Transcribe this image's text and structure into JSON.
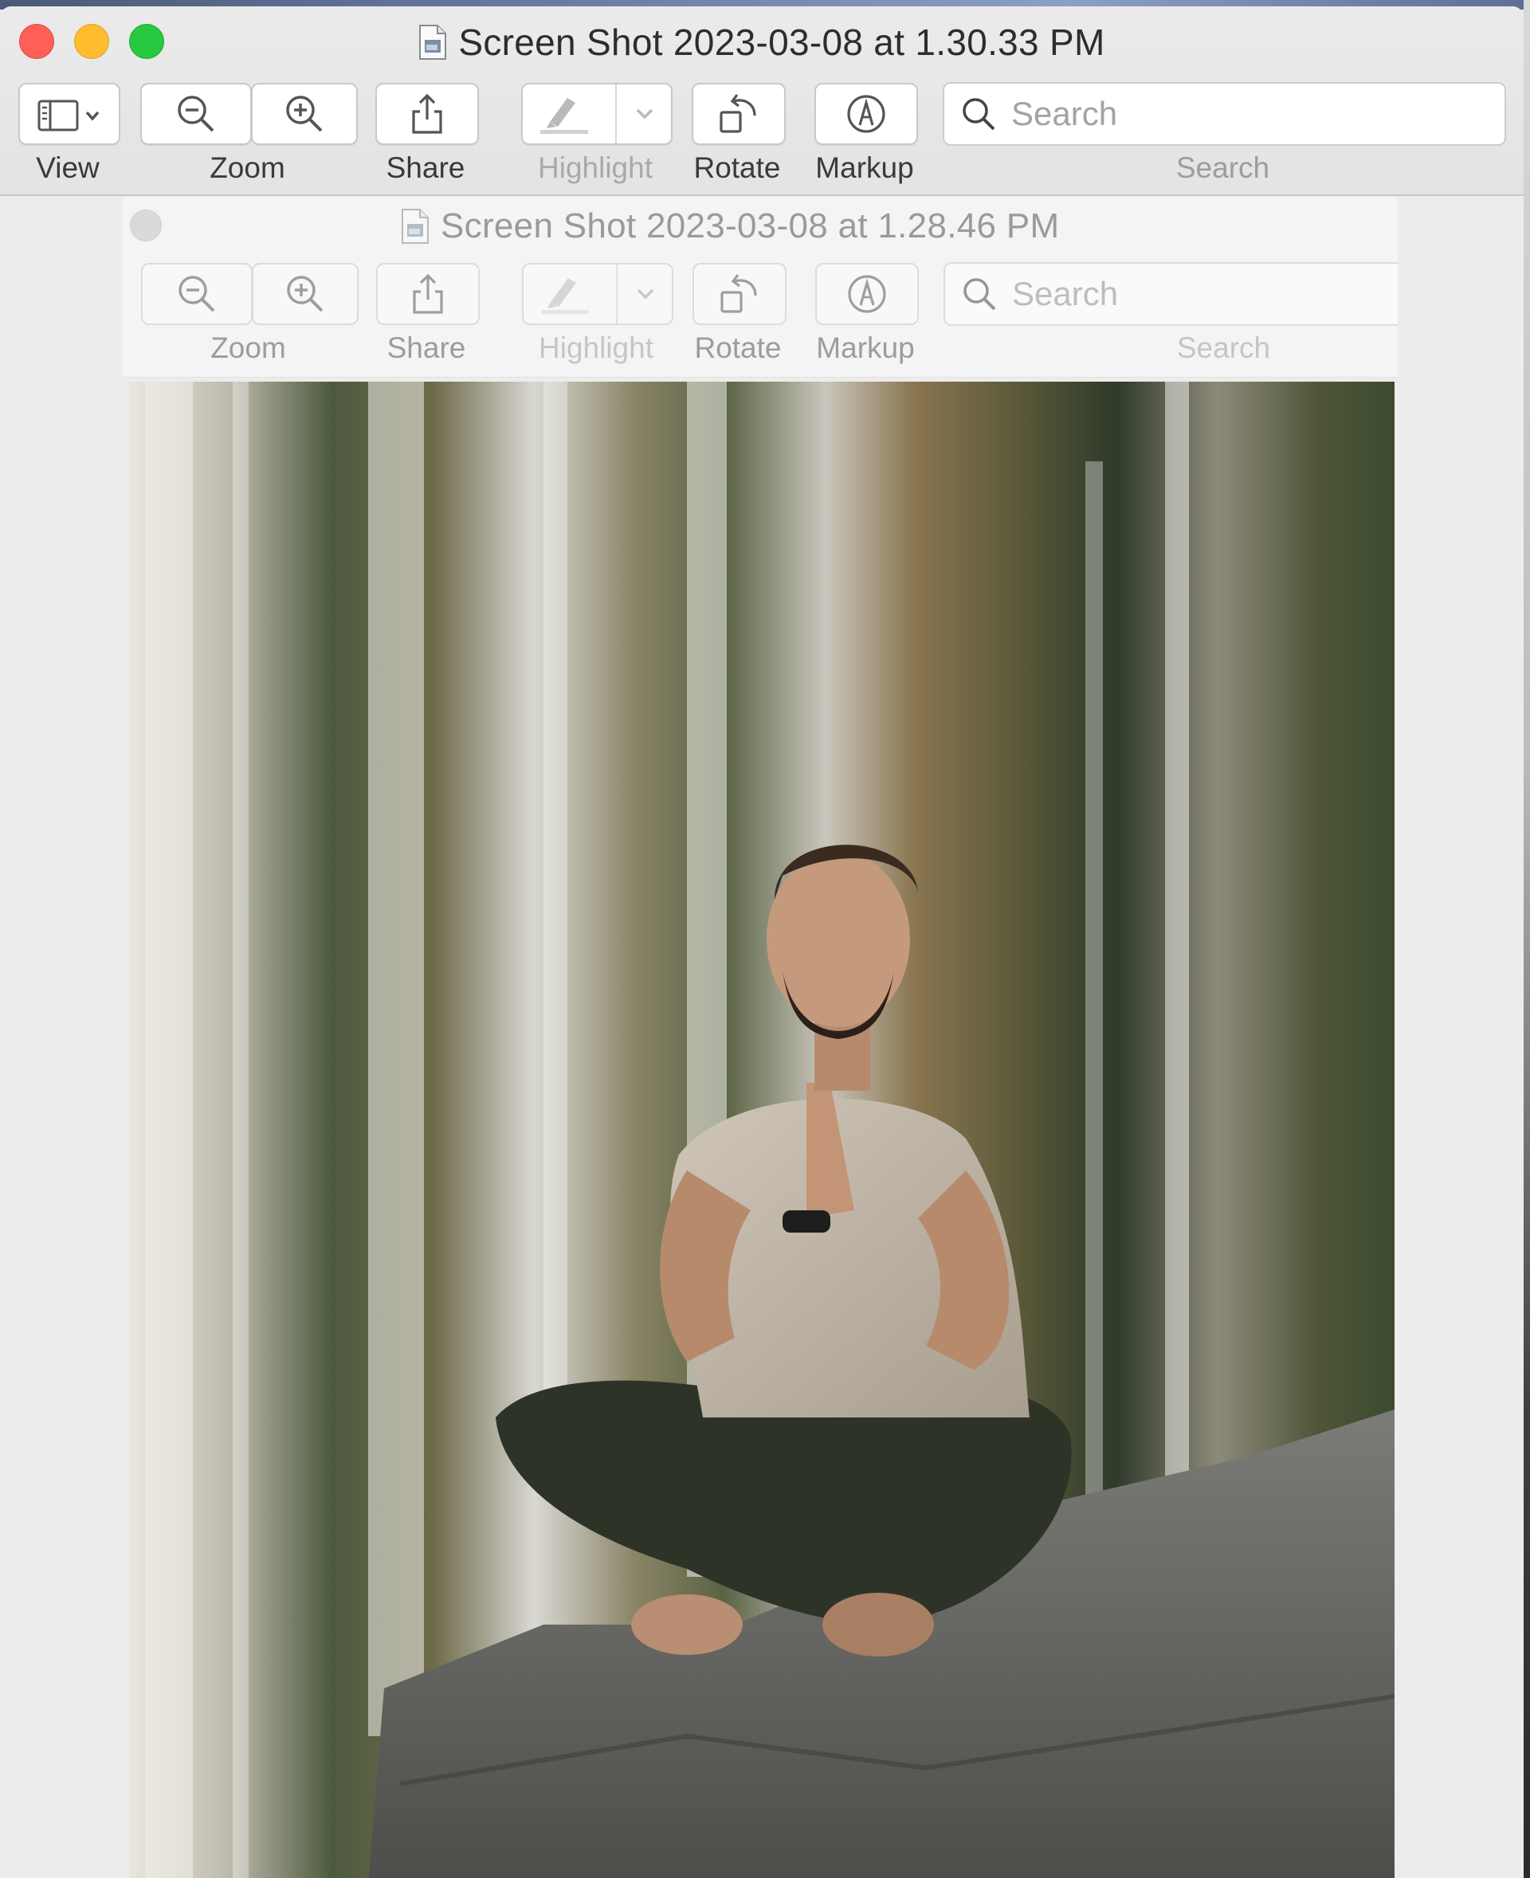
{
  "front_window": {
    "title": "Screen Shot 2023-03-08 at 1.30.33 PM",
    "toolbar": {
      "view_label": "View",
      "zoom_label": "Zoom",
      "share_label": "Share",
      "highlight_label": "Highlight",
      "rotate_label": "Rotate",
      "markup_label": "Markup",
      "search_label": "Search",
      "search_placeholder": "Search"
    }
  },
  "back_window": {
    "title": "Screen Shot 2023-03-08 at 1.28.46 PM",
    "toolbar": {
      "zoom_label": "Zoom",
      "share_label": "Share",
      "highlight_label": "Highlight",
      "rotate_label": "Rotate",
      "markup_label": "Markup",
      "search_label": "Search",
      "search_placeholder": "Search"
    }
  },
  "colors": {
    "close": "#fe5f57",
    "minimize": "#febc2e",
    "maximize": "#28c840"
  }
}
